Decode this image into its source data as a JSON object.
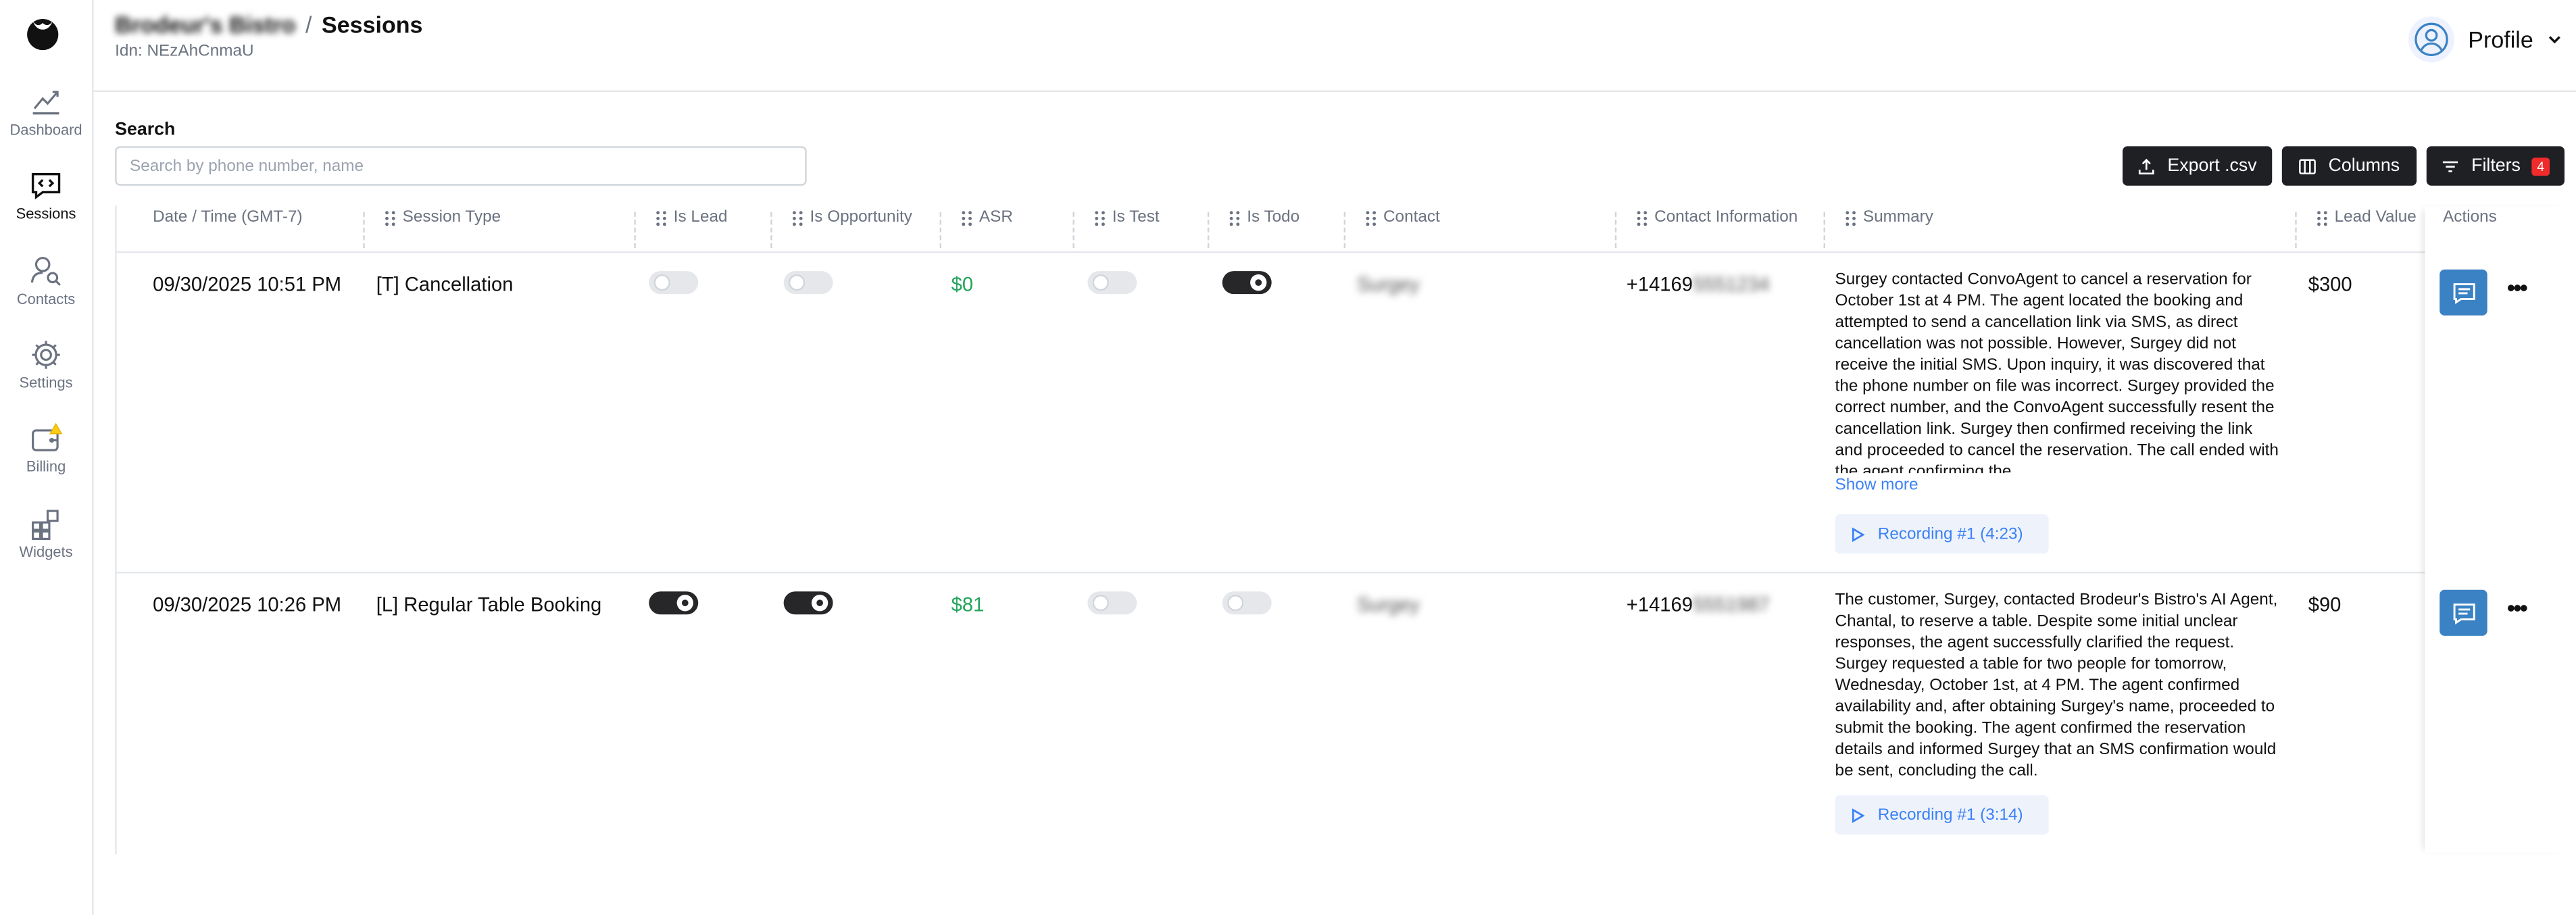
{
  "sidebar": {
    "items": [
      {
        "label": "Dashboard",
        "icon": "chart-line-icon"
      },
      {
        "label": "Sessions",
        "icon": "chat-code-icon"
      },
      {
        "label": "Contacts",
        "icon": "user-search-icon"
      },
      {
        "label": "Settings",
        "icon": "gear-icon"
      },
      {
        "label": "Billing",
        "icon": "wallet-icon"
      },
      {
        "label": "Widgets",
        "icon": "widgets-icon"
      }
    ]
  },
  "header": {
    "business": "Brodeur's Bistro",
    "separator": "/",
    "title": "Sessions",
    "idn": "Idn: NEzAhCnmaU",
    "profile_label": "Profile"
  },
  "search": {
    "label": "Search",
    "placeholder": "Search by phone number, name"
  },
  "toolbar": {
    "export_label": "Export .csv",
    "columns_label": "Columns",
    "filters_label": "Filters",
    "filters_count": "4"
  },
  "table": {
    "columns": [
      "Date / Time (GMT-7)",
      "Session Type",
      "Is Lead",
      "Is Opportunity",
      "ASR",
      "Is Test",
      "Is Todo",
      "Contact",
      "Contact Information",
      "Summary",
      "Lead Value",
      "Actions"
    ],
    "rows": [
      {
        "datetime": "09/30/2025 10:51 PM",
        "session_type": "[T] Cancellation",
        "is_lead": false,
        "is_opportunity": false,
        "asr": "$0",
        "is_test": false,
        "is_todo": true,
        "contact": "Surgey",
        "contact_info": "+14169",
        "contact_info_hidden": "5551234",
        "summary": "Surgey contacted ConvoAgent to cancel a reservation for October 1st at 4 PM. The agent located the booking and attempted to send a cancellation link via SMS, as direct cancellation was not possible. However, Surgey did not receive the initial SMS. Upon inquiry, it was discovered that the phone number on file was incorrect. Surgey provided the correct number, and the ConvoAgent successfully resent the cancellation link. Surgey then confirmed receiving the link and proceeded to cancel the reservation. The call ended with the agent confirming the",
        "show_more": "Show more",
        "recording": "Recording #1 (4:23)",
        "lead_value": "$300"
      },
      {
        "datetime": "09/30/2025 10:26 PM",
        "session_type": "[L] Regular Table Booking",
        "is_lead": true,
        "is_opportunity": true,
        "asr": "$81",
        "is_test": false,
        "is_todo": false,
        "contact": "Surgey",
        "contact_info": "+14169",
        "contact_info_hidden": "5551987",
        "summary": "The customer, Surgey, contacted Brodeur's Bistro's AI Agent, Chantal, to reserve a table. Despite some initial unclear responses, the agent successfully clarified the request. Surgey requested a table for two people for tomorrow, Wednesday, October 1st, at 4 PM. The agent confirmed availability and, after obtaining Surgey's name, proceeded to submit the booking. The agent confirmed the reservation details and informed Surgey that an SMS confirmation would be sent, concluding the call.",
        "recording": "Recording #1 (3:14)",
        "lead_value": "$90"
      }
    ]
  },
  "colors": {
    "accent_blue": "#3b82c4",
    "link_blue": "#3b82f6",
    "asr_green": "#22a55b",
    "dark_button": "#1f2024",
    "badge_red": "#ef2b2b"
  }
}
